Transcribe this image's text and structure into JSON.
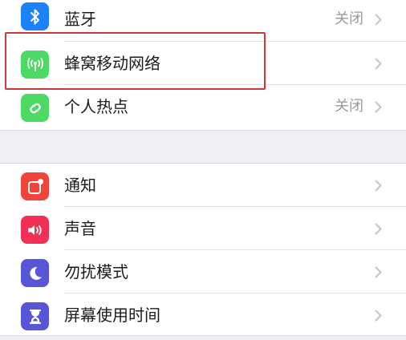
{
  "settings": {
    "group1": [
      {
        "label": "蓝牙",
        "value": "关闭",
        "icon": "bluetooth-icon",
        "color": "#1a82fb"
      },
      {
        "label": "蜂窝移动网络",
        "value": "",
        "icon": "antenna-icon",
        "color": "#4cd964"
      },
      {
        "label": "个人热点",
        "value": "关闭",
        "icon": "hotspot-icon",
        "color": "#4cd964"
      }
    ],
    "group2": [
      {
        "label": "通知",
        "value": "",
        "icon": "notification-icon",
        "color": "#f0453a"
      },
      {
        "label": "声音",
        "value": "",
        "icon": "speaker-icon",
        "color": "#f22f55"
      },
      {
        "label": "勿扰模式",
        "value": "",
        "icon": "moon-icon",
        "color": "#5856d6"
      },
      {
        "label": "屏幕使用时间",
        "value": "",
        "icon": "hourglass-icon",
        "color": "#5856d6"
      }
    ]
  },
  "highlight": {
    "target": "蜂窝移动网络",
    "color": "#d0363a"
  }
}
